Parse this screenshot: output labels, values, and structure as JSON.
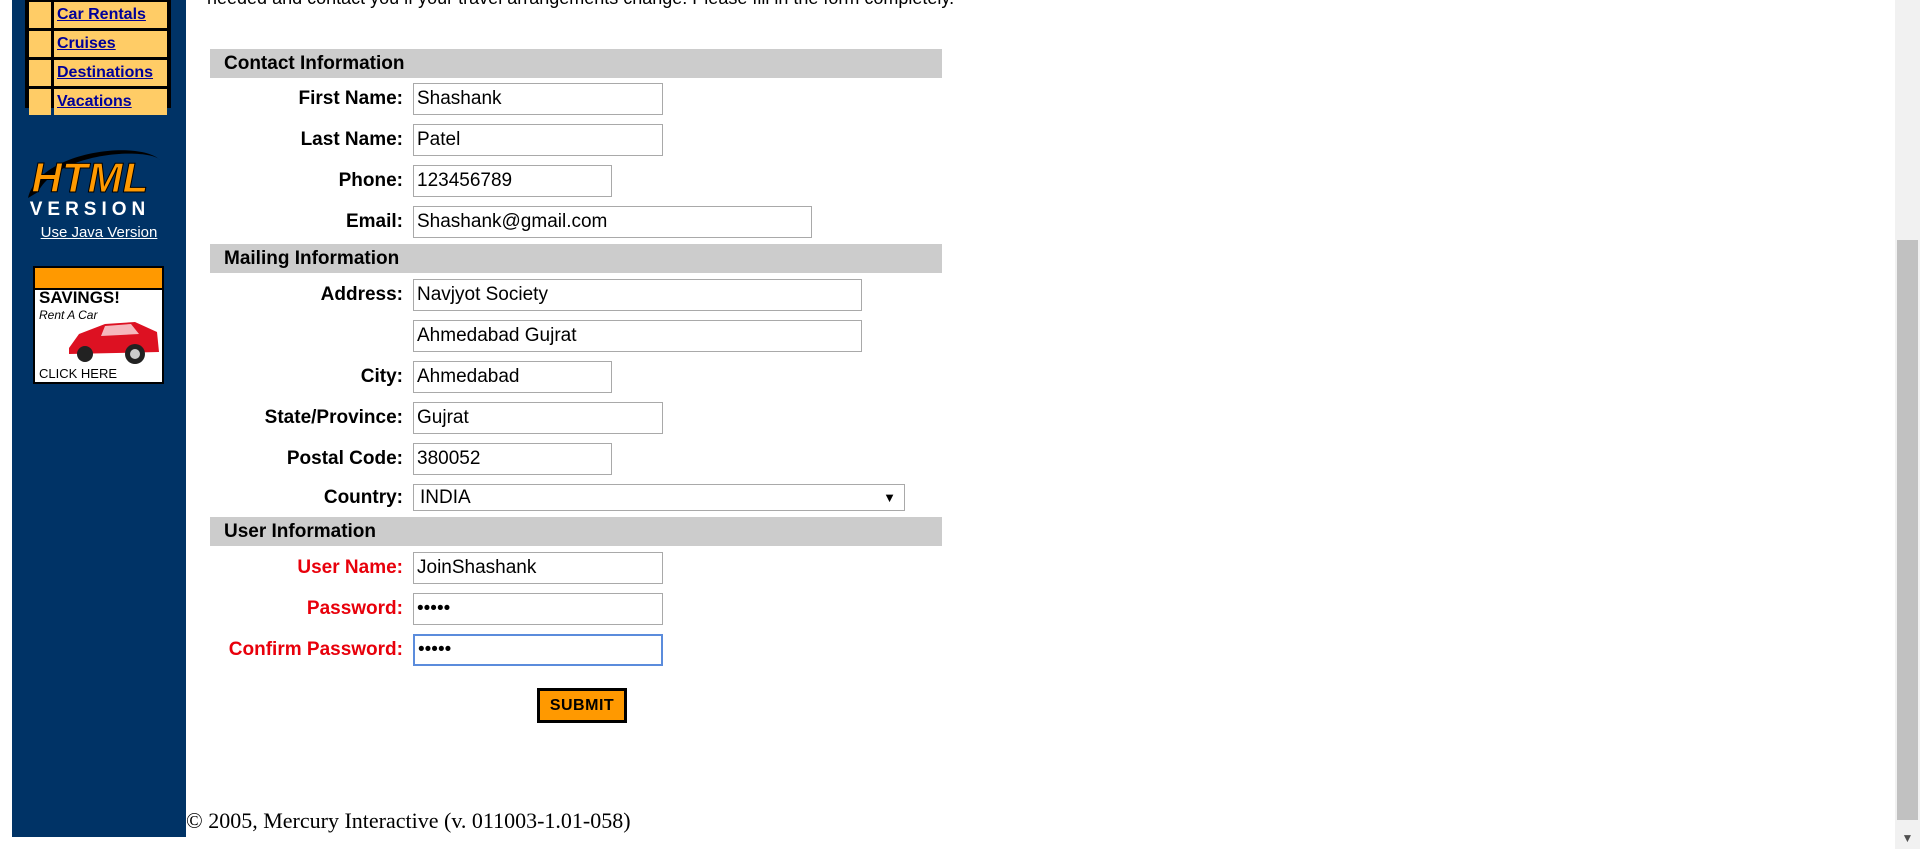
{
  "sidebar": {
    "nav": [
      "Car Rentals",
      "Cruises",
      "Destinations",
      "Vacations"
    ],
    "logo_top": "HTML",
    "logo_bottom": "VERSION",
    "java_link": "Use Java Version",
    "ad": {
      "line1": "SAVINGS!",
      "line2": "Rent A Car",
      "line3": "CLICK HERE"
    }
  },
  "intro_text": "needed and contact you if your travel arrangements change. Please fill in the form completely.",
  "sections": {
    "contact": "Contact Information",
    "mailing": "Mailing Information",
    "user": "User Information"
  },
  "labels": {
    "first_name": "First Name:",
    "last_name": "Last Name:",
    "phone": "Phone:",
    "email": "Email:",
    "address": "Address:",
    "city": "City:",
    "state": "State/Province:",
    "postal": "Postal Code:",
    "country": "Country:",
    "user_name": "User Name:",
    "password": "Password:",
    "confirm_password": "Confirm Password:"
  },
  "values": {
    "first_name": "Shashank",
    "last_name": "Patel",
    "phone": "123456789",
    "email": "Shashank@gmail.com",
    "address1": "Navjyot Society",
    "address2": "Ahmedabad Gujrat",
    "city": "Ahmedabad",
    "state": "Gujrat",
    "postal": "380052",
    "country": "INDIA",
    "user_name": "JoinShashank",
    "password": "•••••",
    "confirm_password": "•••••"
  },
  "submit_label": "SUBMIT",
  "footer": "© 2005, Mercury Interactive (v. 011003-1.01-058)",
  "colors": {
    "sidebar": "#003366",
    "nav": "#ffcc66",
    "accent": "#ff9900",
    "section": "#cccccc",
    "required": "#e8000b"
  }
}
